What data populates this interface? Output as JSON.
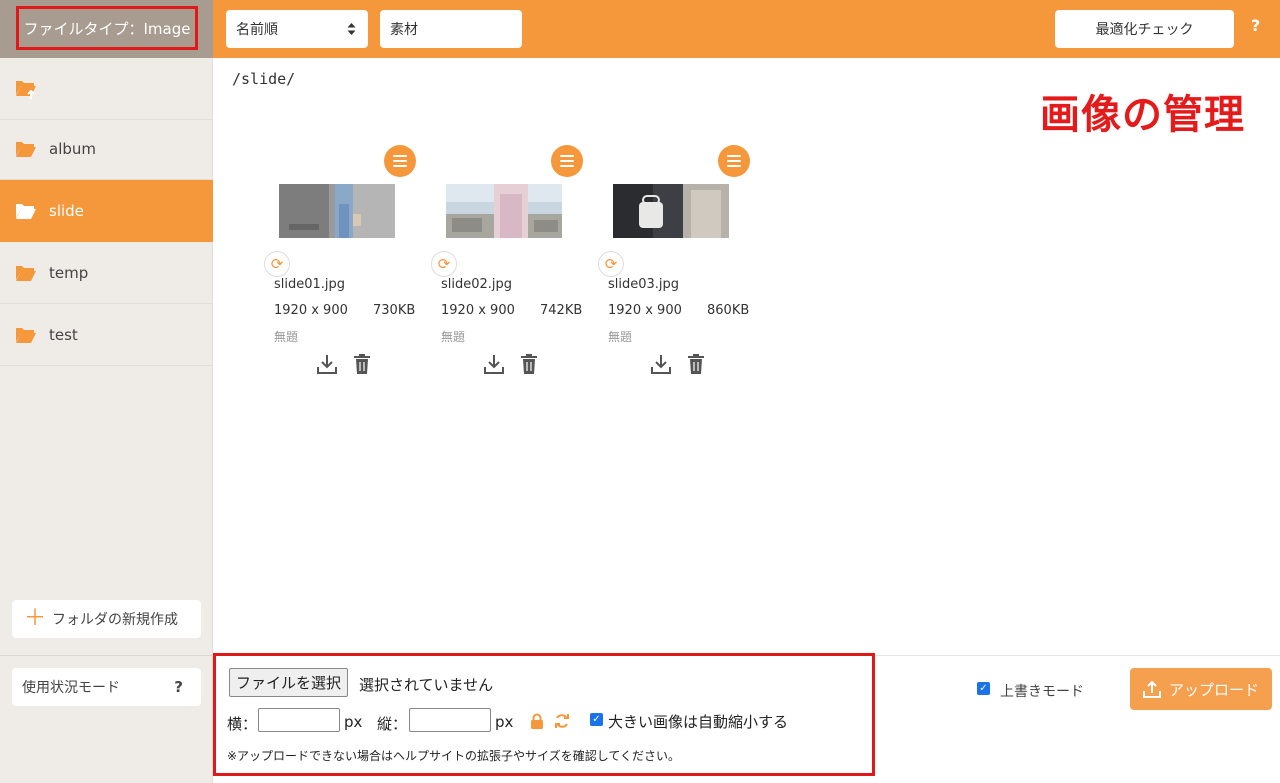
{
  "sidebar": {
    "filetype_label": "ファイルタイプ：Image",
    "folders": [
      {
        "label": "album",
        "icon": "folder-open-icon"
      },
      {
        "label": "slide",
        "icon": "folder-open-icon",
        "active": true
      },
      {
        "label": "temp",
        "icon": "folder-open-icon"
      },
      {
        "label": "test",
        "icon": "folder-open-icon"
      }
    ],
    "new_folder_label": "フォルダの新規作成",
    "usage_mode_label": "使用状況モード",
    "usage_help": "?"
  },
  "topbar": {
    "sort_value": "名前順",
    "search_value": "素材",
    "optimize_label": "最適化チェック",
    "help": "?"
  },
  "main": {
    "path": "/slide/",
    "heading": "画像の管理",
    "files": [
      {
        "name": "slide01.jpg",
        "dims": "1920 x 900",
        "size": "730KB",
        "title": "無題"
      },
      {
        "name": "slide02.jpg",
        "dims": "1920 x 900",
        "size": "742KB",
        "title": "無題"
      },
      {
        "name": "slide03.jpg",
        "dims": "1920 x 900",
        "size": "860KB",
        "title": "無題"
      }
    ]
  },
  "upload": {
    "choose_file_label": "ファイルを選択",
    "no_file_text": "選択されていません",
    "width_label": "横：",
    "height_label": "縦：",
    "px": "px",
    "auto_shrink_label": "大きい画像は自動縮小する",
    "auto_shrink_checked": true,
    "note": "※アップロードできない場合はヘルプサイトの拡張子やサイズを確認してください。",
    "overwrite_label": "上書きモード",
    "overwrite_checked": true,
    "upload_label": "アップロード"
  },
  "colors": {
    "accent": "#f5973b",
    "highlight_red": "#e01818",
    "sidebar_bg": "#efebe6"
  }
}
